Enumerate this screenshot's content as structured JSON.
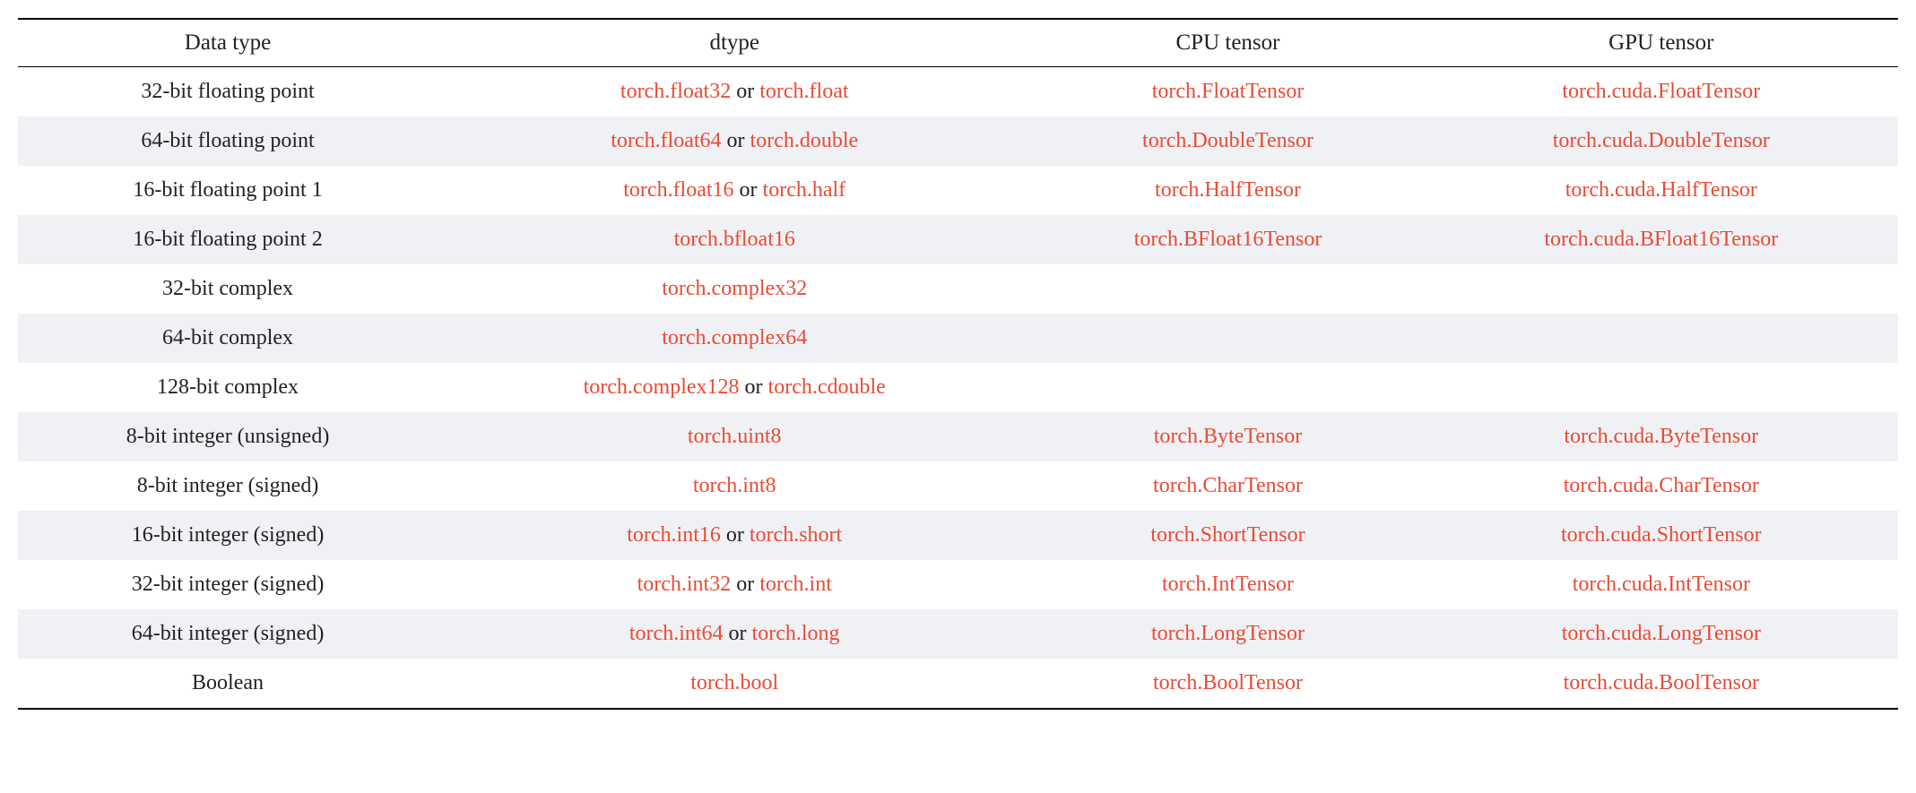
{
  "headers": {
    "col0": "Data type",
    "col1": "dtype",
    "col2": "CPU tensor",
    "col3": "GPU tensor"
  },
  "or_text": " or ",
  "rows": [
    {
      "data_type": "32-bit floating point",
      "dtype_a": "torch.float32",
      "dtype_b": "torch.float",
      "cpu": "torch.FloatTensor",
      "gpu": "torch.cuda.FloatTensor"
    },
    {
      "data_type": "64-bit floating point",
      "dtype_a": "torch.float64",
      "dtype_b": "torch.double",
      "cpu": "torch.DoubleTensor",
      "gpu": "torch.cuda.DoubleTensor"
    },
    {
      "data_type": "16-bit floating point 1",
      "dtype_a": "torch.float16",
      "dtype_b": "torch.half",
      "cpu": "torch.HalfTensor",
      "gpu": "torch.cuda.HalfTensor"
    },
    {
      "data_type": "16-bit floating point 2",
      "dtype_a": "torch.bfloat16",
      "dtype_b": "",
      "cpu": "torch.BFloat16Tensor",
      "gpu": "torch.cuda.BFloat16Tensor"
    },
    {
      "data_type": "32-bit complex",
      "dtype_a": "torch.complex32",
      "dtype_b": "",
      "cpu": "",
      "gpu": ""
    },
    {
      "data_type": "64-bit complex",
      "dtype_a": "torch.complex64",
      "dtype_b": "",
      "cpu": "",
      "gpu": ""
    },
    {
      "data_type": "128-bit complex",
      "dtype_a": "torch.complex128",
      "dtype_b": "torch.cdouble",
      "cpu": "",
      "gpu": ""
    },
    {
      "data_type": "8-bit integer (unsigned)",
      "dtype_a": "torch.uint8",
      "dtype_b": "",
      "cpu": "torch.ByteTensor",
      "gpu": "torch.cuda.ByteTensor"
    },
    {
      "data_type": "8-bit integer (signed)",
      "dtype_a": "torch.int8",
      "dtype_b": "",
      "cpu": "torch.CharTensor",
      "gpu": "torch.cuda.CharTensor"
    },
    {
      "data_type": "16-bit integer (signed)",
      "dtype_a": "torch.int16",
      "dtype_b": "torch.short",
      "cpu": "torch.ShortTensor",
      "gpu": "torch.cuda.ShortTensor"
    },
    {
      "data_type": "32-bit integer (signed)",
      "dtype_a": "torch.int32",
      "dtype_b": "torch.int",
      "cpu": "torch.IntTensor",
      "gpu": "torch.cuda.IntTensor"
    },
    {
      "data_type": "64-bit integer (signed)",
      "dtype_a": "torch.int64",
      "dtype_b": "torch.long",
      "cpu": "torch.LongTensor",
      "gpu": "torch.cuda.LongTensor"
    },
    {
      "data_type": "Boolean",
      "dtype_a": "torch.bool",
      "dtype_b": "",
      "cpu": "torch.BoolTensor",
      "gpu": "torch.cuda.BoolTensor"
    }
  ]
}
